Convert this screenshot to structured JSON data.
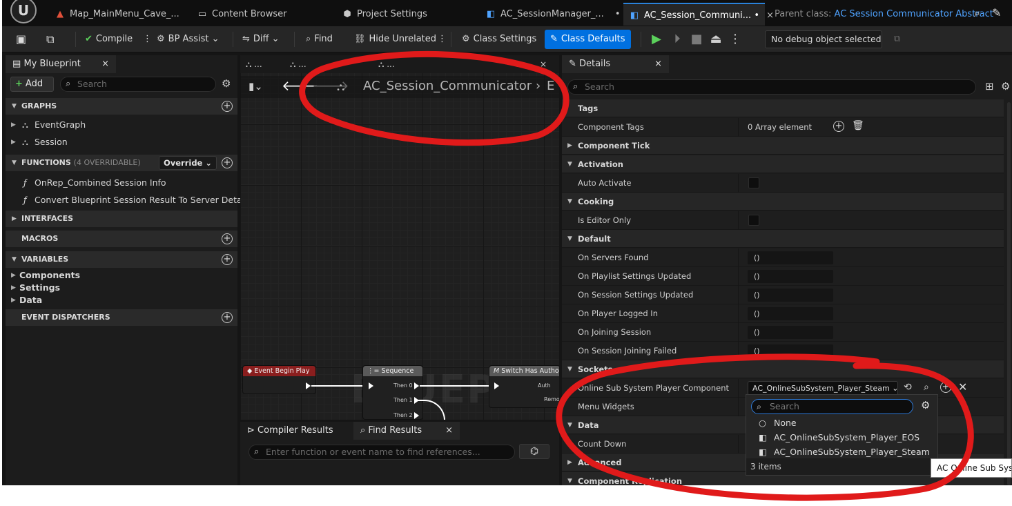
{
  "tabs": [
    {
      "label": "Map_MainMenu_Cave_...",
      "icon": "level-icon",
      "active": false
    },
    {
      "label": "Content Browser",
      "icon": "folder-icon",
      "active": false
    },
    {
      "label": "Project Settings",
      "icon": "settings-cube-icon",
      "active": false
    },
    {
      "label": "AC_SessionManager_...",
      "modified": "•",
      "icon": "blueprint-icon",
      "active": false
    },
    {
      "label": "AC_Session_Communi...",
      "modified": "•",
      "close": "×",
      "icon": "blueprint-icon",
      "active": true
    }
  ],
  "parent_class": {
    "label": "Parent class:",
    "value": "AC Session Communicator Abstract"
  },
  "toolbar": {
    "compile": "Compile",
    "bp_assist": "BP Assist",
    "diff": "Diff",
    "find": "Find",
    "hide_unrelated": "Hide Unrelated",
    "class_settings": "Class Settings",
    "class_defaults": "Class Defaults",
    "debug_object": "No debug object selected"
  },
  "my_blueprint": {
    "tab_label": "My Blueprint",
    "close": "×",
    "add_label": "Add",
    "search_placeholder": "Search",
    "graphs": {
      "title": "GRAPHS",
      "items": [
        "EventGraph",
        "Session"
      ]
    },
    "functions": {
      "title": "FUNCTIONS",
      "subtitle": "(4 OVERRIDABLE)",
      "override_label": "Override",
      "items": [
        "OnRep_Combined Session Info",
        "Convert Blueprint Session Result To Server Details"
      ]
    },
    "interfaces": "INTERFACES",
    "macros": "MACROS",
    "variables": {
      "title": "VARIABLES",
      "items": [
        "Components",
        "Settings",
        "Data"
      ]
    },
    "event_dispatchers": "EVENT DISPATCHERS"
  },
  "graph": {
    "tabs": [
      "...",
      "...",
      "...",
      "..."
    ],
    "breadcrumb": "AC_Session_Communicator",
    "breadcrumb_tail": "E",
    "watermark": "BLUEPRINT",
    "nodes": {
      "event_begin_play": "Event Begin Play",
      "sequence": "Sequence",
      "sequence_pins": [
        "Then 0",
        "Then 1",
        "Then 2"
      ],
      "switch_authority": "Switch Has Authority",
      "switch_pins": [
        "Auth",
        "Remot"
      ]
    }
  },
  "bottom": {
    "compiler_results": "Compiler Results",
    "find_results": "Find Results",
    "close": "×",
    "find_placeholder": "Enter function or event name to find references..."
  },
  "details": {
    "tab_label": "Details",
    "close": "×",
    "search_placeholder": "Search",
    "sections": {
      "tags": "Tags",
      "component_tick": "Component Tick",
      "activation": "Activation",
      "cooking": "Cooking",
      "default": "Default",
      "sockets": "Sockets",
      "data": "Data",
      "advanced": "Advanced",
      "component_replication": "Component Replication"
    },
    "component_tags": {
      "label": "Component Tags",
      "value": "0 Array element"
    },
    "auto_activate": "Auto Activate",
    "is_editor_only": "Is Editor Only",
    "events": [
      {
        "label": "On Servers Found",
        "value": "()"
      },
      {
        "label": "On Playlist Settings Updated",
        "value": "()"
      },
      {
        "label": "On Session Settings Updated",
        "value": "()"
      },
      {
        "label": "On Player Logged In",
        "value": "()"
      },
      {
        "label": "On Joining Session",
        "value": "()"
      },
      {
        "label": "On Session Joining Failed",
        "value": "()"
      }
    ],
    "online_sub_system": {
      "label": "Online Sub System Player Component",
      "value": "AC_OnlineSubSystem_Player_Steam"
    },
    "menu_widgets": "Menu Widgets",
    "count_down": "Count Down"
  },
  "dropdown": {
    "search_placeholder": "Search",
    "items": [
      "None",
      "AC_OnlineSubSystem_Player_EOS",
      "AC_OnlineSubSystem_Player_Steam"
    ],
    "count": "3 items"
  },
  "tooltip": "AC Online Sub System",
  "annotation_color": "#e01a1a",
  "accent_color": "#0070e0"
}
